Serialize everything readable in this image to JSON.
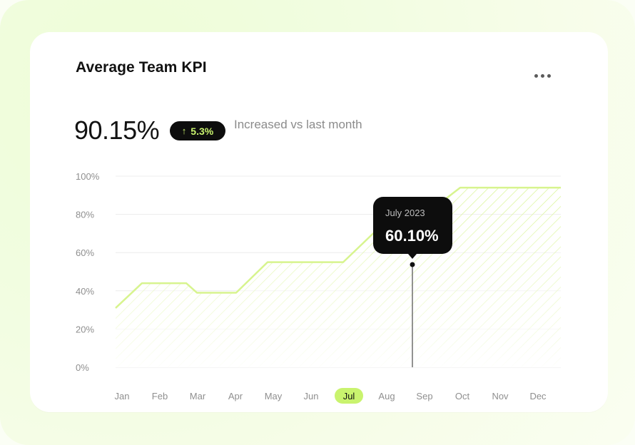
{
  "card": {
    "title": "Average Team KPI",
    "menu_icon": "more-horizontal-icon",
    "kpi_value": "90.15%",
    "badge": {
      "arrow_icon": "arrow-up-icon",
      "text": "5.3%"
    },
    "subtext": "Increased vs last month"
  },
  "colors": {
    "accent": "#c9f36e",
    "line": "#d7f48e",
    "text_primary": "#111111",
    "text_muted": "#8b8b8b",
    "tooltip_bg": "#0d0d0d"
  },
  "chart_data": {
    "type": "area",
    "categories": [
      "Jan",
      "Feb",
      "Mar",
      "Apr",
      "May",
      "Jun",
      "Jul",
      "Aug",
      "Sep",
      "Oct",
      "Nov",
      "Dec"
    ],
    "y_ticks": [
      "100%",
      "80%",
      "60%",
      "40%",
      "20%",
      "0%"
    ],
    "ylim": [
      0,
      100
    ],
    "grid": true,
    "series": [
      {
        "points": [
          {
            "month": "Jan",
            "value": 31
          },
          {
            "month": "Feb",
            "value": 44
          },
          {
            "month": "Mar",
            "value": 44
          },
          {
            "month": "Mar",
            "value": 39
          },
          {
            "month": "Apr",
            "value": 39
          },
          {
            "month": "May",
            "value": 55
          },
          {
            "month": "Jun",
            "value": 55
          },
          {
            "month": "Jul",
            "value": 70
          },
          {
            "month": "Aug",
            "value": 81
          },
          {
            "month": "Sep",
            "value": 81
          },
          {
            "month": "Oct",
            "value": 94
          },
          {
            "month": "Nov",
            "value": 94
          },
          {
            "month": "Dec",
            "value": 94
          }
        ]
      }
    ],
    "highlighted_category": "Jul",
    "tooltip": {
      "label": "July 2023",
      "value": "60.10%",
      "marker_month": "Aug"
    }
  }
}
